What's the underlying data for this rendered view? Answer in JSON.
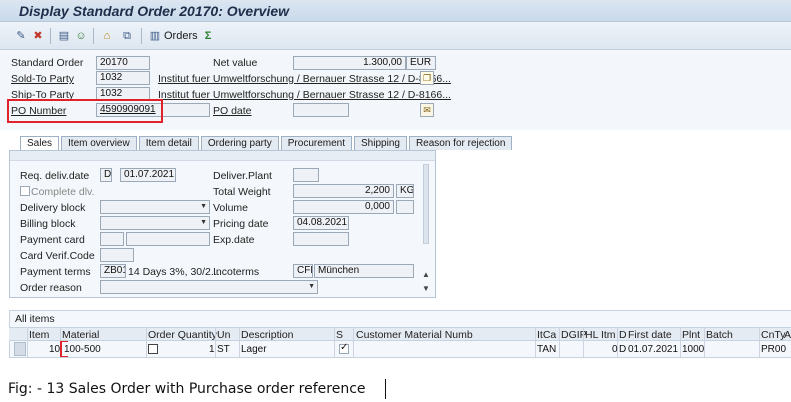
{
  "window": {
    "title": "Display Standard Order 20170: Overview"
  },
  "toolbar": {
    "orders_label": "Orders"
  },
  "header": {
    "standard_order_label": "Standard Order",
    "standard_order_value": "20170",
    "net_value_label": "Net value",
    "net_value": "1.300,00",
    "currency": "EUR",
    "sold_to_label": "Sold-To Party",
    "sold_to_value": "1032",
    "sold_to_desc": "Institut fuer Umweltforschung / Bernauer Strasse 12 / D-8166...",
    "ship_to_label": "Ship-To Party",
    "ship_to_value": "1032",
    "ship_to_desc": "Institut fuer Umweltforschung / Bernauer Strasse 12 / D-8166...",
    "po_number_label": "PO Number",
    "po_number_value": "4590909091",
    "po_date_label": "PO date",
    "po_date_value": ""
  },
  "tabs": [
    {
      "label": "Sales"
    },
    {
      "label": "Item overview"
    },
    {
      "label": "Item detail"
    },
    {
      "label": "Ordering party"
    },
    {
      "label": "Procurement"
    },
    {
      "label": "Shipping"
    },
    {
      "label": "Reason for rejection"
    }
  ],
  "sales": {
    "req_deliv_date_label": "Req. deliv.date",
    "req_deliv_date_type": "D",
    "req_deliv_date_value": "01.07.2021",
    "deliver_plant_label": "Deliver.Plant",
    "deliver_plant_value": "",
    "complete_dlv_label": "Complete dlv.",
    "total_weight_label": "Total Weight",
    "total_weight_value": "2,200",
    "total_weight_unit": "KG",
    "delivery_block_label": "Delivery block",
    "delivery_block_value": "",
    "volume_label": "Volume",
    "volume_value": "0,000",
    "volume_unit": "",
    "billing_block_label": "Billing block",
    "billing_block_value": "",
    "pricing_date_label": "Pricing date",
    "pricing_date_value": "04.08.2021",
    "payment_card_label": "Payment card",
    "payment_card_value": "",
    "exp_date_label": "Exp.date",
    "exp_date_value": "",
    "card_verif_label": "Card Verif.Code",
    "card_verif_value": "",
    "payment_terms_label": "Payment terms",
    "payment_terms_code": "ZB01",
    "payment_terms_desc": "14 Days 3%, 30/2...",
    "incoterms_label": "Incoterms",
    "incoterms_code": "CFR",
    "incoterms_place": "München",
    "order_reason_label": "Order reason",
    "order_reason_value": ""
  },
  "items": {
    "title": "All items",
    "columns": [
      "Item",
      "Material",
      "Order Quantity",
      "Un",
      "Description",
      "S",
      "Customer Material Numb",
      "ItCa",
      "DGIP",
      "HL Itm",
      "D",
      "First date",
      "Plnt",
      "Batch",
      "CnTy",
      "A"
    ],
    "rows": [
      {
        "item": "10",
        "material": "100-500",
        "quantity": "1",
        "unit": "ST",
        "description": "Lager",
        "itca": "TAN",
        "hl_itm": "0",
        "d": "D",
        "first_date": "01.07.2021",
        "plnt": "1000",
        "cnty": "PR00"
      }
    ]
  },
  "caption": "Fig: - 13 Sales Order with Purchase order reference"
}
